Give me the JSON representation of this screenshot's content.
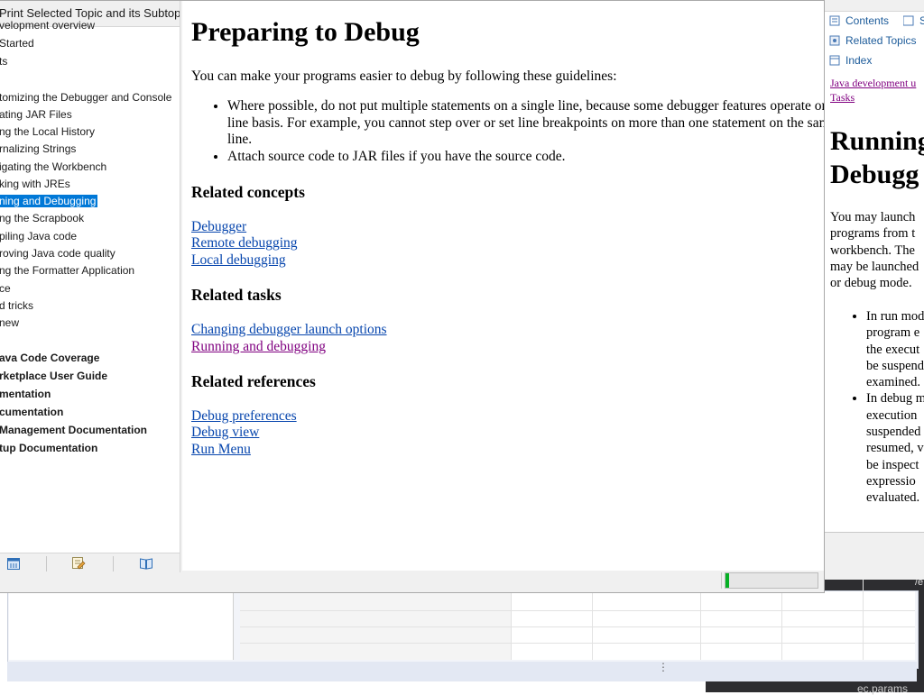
{
  "background": {
    "dark_panel_text": "ec.params",
    "right_edge_text": "/e"
  },
  "help": {
    "toc_header": "Print Selected Topic and its Subtopics",
    "toc_items": [
      {
        "label": "velopment overview",
        "bold": false
      },
      {
        "label": "Started",
        "bold": false
      },
      {
        "label": "ts",
        "bold": false
      },
      {
        "label": "",
        "bold": false
      },
      {
        "label": "tomizing the Debugger and Console",
        "bold": false
      },
      {
        "label": "ating JAR Files",
        "bold": false
      },
      {
        "label": "ng the Local History",
        "bold": false
      },
      {
        "label": "rnalizing Strings",
        "bold": false
      },
      {
        "label": "igating the Workbench",
        "bold": false
      },
      {
        "label": "king with JREs",
        "bold": false
      },
      {
        "label": "ning and Debugging",
        "bold": false,
        "selected": true
      },
      {
        "label": "ng the Scrapbook",
        "bold": false
      },
      {
        "label": "piling Java code",
        "bold": false
      },
      {
        "label": "roving Java code quality",
        "bold": false
      },
      {
        "label": "ng the Formatter Application",
        "bold": false
      },
      {
        "label": "ce",
        "bold": false
      },
      {
        "label": "d tricks",
        "bold": false
      },
      {
        "label": "new",
        "bold": false
      },
      {
        "label": "",
        "bold": false
      },
      {
        "label": "ava Code Coverage",
        "bold": true
      },
      {
        "label": "rketplace User Guide",
        "bold": true
      },
      {
        "label": "mentation",
        "bold": true
      },
      {
        "label": "cumentation",
        "bold": true
      },
      {
        "label": "Management Documentation",
        "bold": true
      },
      {
        "label": "tup Documentation",
        "bold": true
      }
    ],
    "page_title": "Preparing to Debug",
    "intro": "You can make your programs easier to debug by following these guidelines:",
    "bullets": [
      "Where possible, do not put multiple statements on a single line, because some debugger features operate on a line basis. For example, you cannot step over or set line breakpoints on more than one statement on the same line.",
      "Attach source code to JAR files if you have the source code."
    ],
    "sections": {
      "concepts": {
        "heading": "Related concepts",
        "links": [
          "Debugger",
          "Remote debugging",
          "Local debugging"
        ]
      },
      "tasks": {
        "heading": "Related tasks",
        "links": [
          "Changing debugger launch options",
          "Running and debugging"
        ]
      },
      "references": {
        "heading": "Related references",
        "links": [
          "Debug preferences",
          "Debug view",
          "Run Menu"
        ]
      }
    },
    "progress": 0.04,
    "colors": {
      "link": "#0645ad",
      "visited": "#800080",
      "selection": "#0078d7",
      "progress": "#06b025"
    }
  },
  "right_panel": {
    "nav": [
      "Contents",
      "Se",
      "Related Topics",
      "Index"
    ],
    "breadcrumb_line1": "Java development u",
    "breadcrumb_line2": "Tasks",
    "title_line1": "Running",
    "title_line2": "Debugg",
    "body_lines": [
      "You may launch",
      "programs from t",
      "workbench.  The",
      "may be launched",
      "or debug mode."
    ],
    "bullet1_lines": [
      "In run mod",
      "program e",
      "the execut",
      "be suspend",
      "examined."
    ],
    "bullet2_lines": [
      "In debug m",
      "execution",
      "suspended",
      "resumed, v",
      "be inspect",
      "expressio",
      "evaluated."
    ]
  }
}
